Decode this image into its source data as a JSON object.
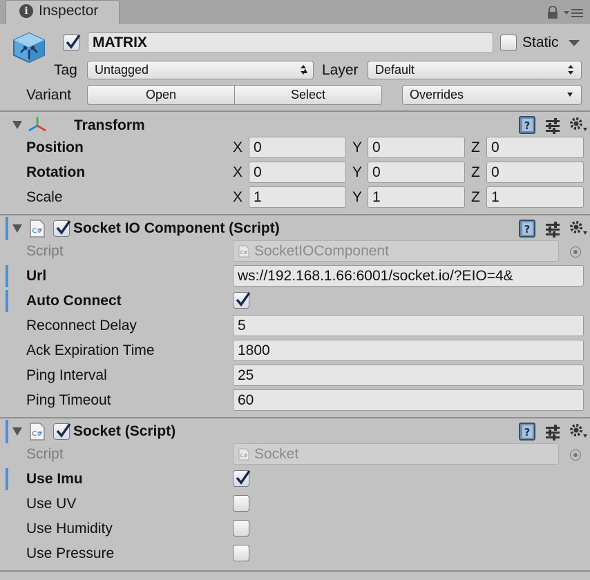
{
  "tab": {
    "label": "Inspector"
  },
  "header": {
    "active": true,
    "name": "MATRIX",
    "static_label": "Static",
    "static_checked": false,
    "tag_label": "Tag",
    "tag_value": "Untagged",
    "layer_label": "Layer",
    "layer_value": "Default",
    "variant_label": "Variant",
    "open_button": "Open",
    "select_button": "Select",
    "overrides_value": "Overrides"
  },
  "transform": {
    "title": "Transform",
    "position": {
      "label": "Position",
      "x": "0",
      "y": "0",
      "z": "0"
    },
    "rotation": {
      "label": "Rotation",
      "x": "0",
      "y": "0",
      "z": "0"
    },
    "scale": {
      "label": "Scale",
      "x": "1",
      "y": "1",
      "z": "1"
    },
    "axis_x": "X",
    "axis_y": "Y",
    "axis_z": "Z"
  },
  "socket_io": {
    "title": "Socket IO Component (Script)",
    "enabled": true,
    "script_label": "Script",
    "script_value": "SocketIOComponent",
    "url_label": "Url",
    "url_value": "ws://192.168.1.66:6001/socket.io/?EIO=4&",
    "auto_connect_label": "Auto Connect",
    "auto_connect": true,
    "reconnect_delay_label": "Reconnect Delay",
    "reconnect_delay": "5",
    "ack_expiration_label": "Ack Expiration Time",
    "ack_expiration": "1800",
    "ping_interval_label": "Ping Interval",
    "ping_interval": "25",
    "ping_timeout_label": "Ping Timeout",
    "ping_timeout": "60"
  },
  "socket": {
    "title": "Socket (Script)",
    "enabled": true,
    "script_label": "Script",
    "script_value": "Socket",
    "use_imu_label": "Use Imu",
    "use_imu": true,
    "use_uv_label": "Use UV",
    "use_uv": false,
    "use_humidity_label": "Use Humidity",
    "use_humidity": false,
    "use_pressure_label": "Use Pressure",
    "use_pressure": false
  },
  "colors": {
    "background": "#c2c2c2",
    "modified_marker": "#4a90d9",
    "checkmark": "#1b2a4a"
  }
}
